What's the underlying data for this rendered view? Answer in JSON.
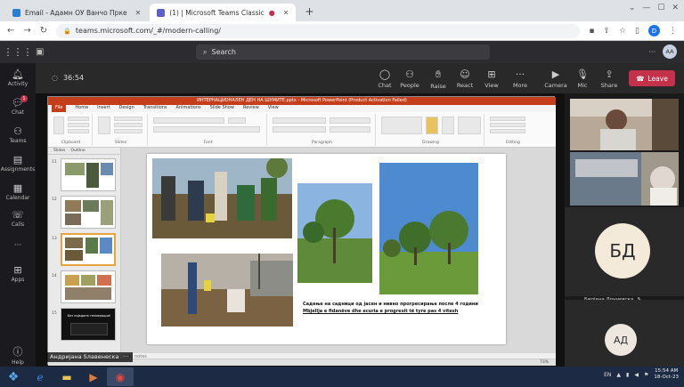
{
  "browser": {
    "tabs": [
      {
        "title": "Email - Адамн ОУ Ванчо Прке",
        "active": false
      },
      {
        "title": "(1) | Microsoft Teams Classic",
        "active": true
      }
    ],
    "new_tab": "+",
    "url": "teams.microsoft.com/_#/modern-calling/",
    "profile_initial": "D"
  },
  "teams": {
    "search_placeholder": "Search",
    "more": "···",
    "user_initials": "AA"
  },
  "rail": [
    {
      "label": "Activity",
      "icon": "bell-icon"
    },
    {
      "label": "Chat",
      "icon": "chat-icon",
      "badge": "1"
    },
    {
      "label": "Teams",
      "icon": "teams-icon"
    },
    {
      "label": "Assignments",
      "icon": "assignments-icon"
    },
    {
      "label": "Calendar",
      "icon": "calendar-icon"
    },
    {
      "label": "Calls",
      "icon": "phone-icon"
    },
    {
      "label": "···",
      "icon": "more-icon"
    },
    {
      "label": "Apps",
      "icon": "apps-icon"
    },
    {
      "label": "Help",
      "icon": "help-icon"
    }
  ],
  "meeting": {
    "timer": "36:54",
    "controls": [
      "Chat",
      "People",
      "Raise",
      "React",
      "View",
      "More",
      "Camera",
      "Mic",
      "Share"
    ],
    "leave_label": "Leave"
  },
  "ppt": {
    "title_text": "ИНТЕРНАЦИОНАЛЕН ДЕН НА ШУМИТЕ.pptx - Microsoft PowerPoint (Product Activation Failed)",
    "menu": [
      "File",
      "Home",
      "Insert",
      "Design",
      "Transitions",
      "Animations",
      "Slide Show",
      "Review",
      "View"
    ],
    "ribbon_groups": [
      "Clipboard",
      "Slides",
      "Font",
      "Paragraph",
      "Drawing",
      "Editing"
    ],
    "thumb_tabs": [
      "Slides",
      "Outline"
    ],
    "thumb_numbers": [
      "11",
      "12",
      "13",
      "14",
      "15"
    ],
    "dark_thumb_text": "Без појадина гениерации!",
    "caption_mk": "Садење на садници од јасен и нивно прогресирање после 4 години",
    "caption_al": "Mbjellja e fidanëve dhe ecuria e progresit të tyre pas 4 vitesh",
    "notes_placeholder": "add notes",
    "zoom": "73%"
  },
  "presenter_name": "Андријана Ѕлавенеска",
  "participants": [
    {
      "initials": "БД",
      "name": "Билјана Дончевска"
    },
    {
      "initials": "АД",
      "name": ""
    }
  ],
  "taskbar": {
    "lang": "EN",
    "time": "15:54 AM",
    "date": "18-Oct-23"
  }
}
